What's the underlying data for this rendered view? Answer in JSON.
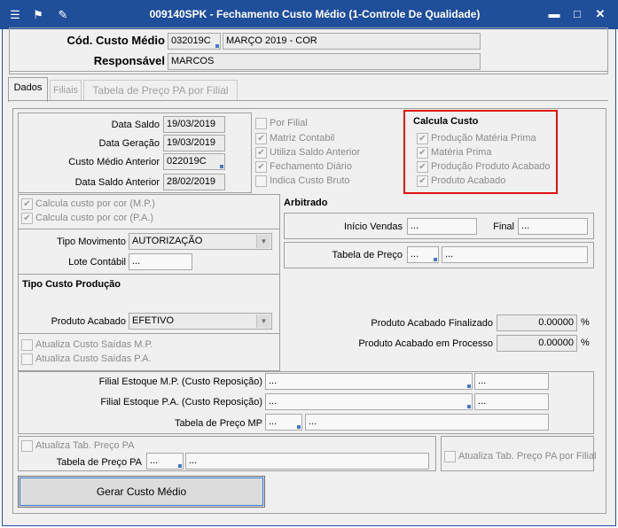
{
  "window": {
    "title": "009140SPK - Fechamento Custo Médio (1-Controle De Qualidade)",
    "icons": [
      "menu-icon",
      "traffic-light-icon",
      "wrench-icon"
    ],
    "controls": [
      "minimize-icon",
      "maximize-icon",
      "close-icon"
    ],
    "control_glyphs": {
      "minimize": "▬",
      "maximize": "□",
      "close": "✕",
      "menu": "☰",
      "traffic": "⚑",
      "wrench": "✎"
    }
  },
  "header": {
    "cod_label": "Cód. Custo Médio",
    "cod_value": "032019C",
    "cod_desc": "MARÇO 2019 - COR",
    "resp_label": "Responsável",
    "resp_value": "MARCOS"
  },
  "tabs": [
    {
      "label": "Dados",
      "active": true
    },
    {
      "label": "Filiais",
      "active": false
    },
    {
      "label": "Tabela de Preço PA por Filial",
      "active": false
    }
  ],
  "dates": {
    "data_saldo_label": "Data Saldo",
    "data_saldo": "19/03/2019",
    "data_geracao_label": "Data Geração",
    "data_geracao": "19/03/2019",
    "custo_anterior_label": "Custo Médio Anterior",
    "custo_anterior": "022019C",
    "data_saldo_anterior_label": "Data Saldo Anterior",
    "data_saldo_anterior": "28/02/2019"
  },
  "options": [
    {
      "label": "Por Filial",
      "checked": false
    },
    {
      "label": "Matriz Contabil",
      "checked": true
    },
    {
      "label": "Utiliza Saldo Anterior",
      "checked": true
    },
    {
      "label": "Fechamento Diário",
      "checked": true
    },
    {
      "label": "Indica Custo Bruto",
      "checked": false
    }
  ],
  "calcula_custo": {
    "title": "Calcula Custo",
    "items": [
      {
        "label": "Produção Matéria Prima",
        "checked": true
      },
      {
        "label": "Matéria Prima",
        "checked": true
      },
      {
        "label": "Produção Produto Acabado",
        "checked": true
      },
      {
        "label": "Produto Acabado",
        "checked": true
      }
    ]
  },
  "calc_cor": {
    "mp": "Calcula custo por cor (M.P.)",
    "pa": "Calcula custo por cor (P.A.)"
  },
  "movimento": {
    "tipo_label": "Tipo Movimento",
    "tipo_value": "AUTORIZAÇÃO",
    "lote_label": "Lote Contábil",
    "lote_value": "..."
  },
  "arbitrado": {
    "title": "Arbitrado",
    "inicio_label": "Início Vendas",
    "inicio_value": "...",
    "final_label": "Final",
    "final_value": "...",
    "tabela_label": "Tabela de Preço",
    "tabela_code": "...",
    "tabela_desc": "..."
  },
  "tipo_custo": {
    "title": "Tipo Custo Produção",
    "produto_label": "Produto Acabado",
    "produto_value": "EFETIVO",
    "finalizado_label": "Produto Acabado Finalizado",
    "finalizado_value": "0.00000",
    "processo_label": "Produto Acabado em Processo",
    "processo_value": "0.00000",
    "pct": "%"
  },
  "atualiza": {
    "saidas_mp": "Atualiza Custo Saídas M.P.",
    "saidas_pa": "Atualiza Custo Saídas P.A."
  },
  "filial_estoque": {
    "mp_label": "Filial Estoque M.P. (Custo Reposição)",
    "mp_code": "...",
    "mp_desc": "...",
    "pa_label": "Filial Estoque P.A. (Custo Reposição)",
    "pa_code": "...",
    "pa_desc": "...",
    "tabela_mp_label": "Tabela de Preço MP",
    "tabela_mp_code": "...",
    "tabela_mp_desc": "..."
  },
  "preco_pa": {
    "atualiza_label": "Atualiza Tab. Preço PA",
    "tabela_label": "Tabela de Preço PA",
    "tabela_code": "...",
    "tabela_desc": "...",
    "por_filial_label": "Atualiza Tab. Preço PA por Filial"
  },
  "buttons": {
    "gerar": "Gerar Custo Médio"
  },
  "colors": {
    "titlebar": "#1f4e9a",
    "highlight": "#e01010"
  }
}
